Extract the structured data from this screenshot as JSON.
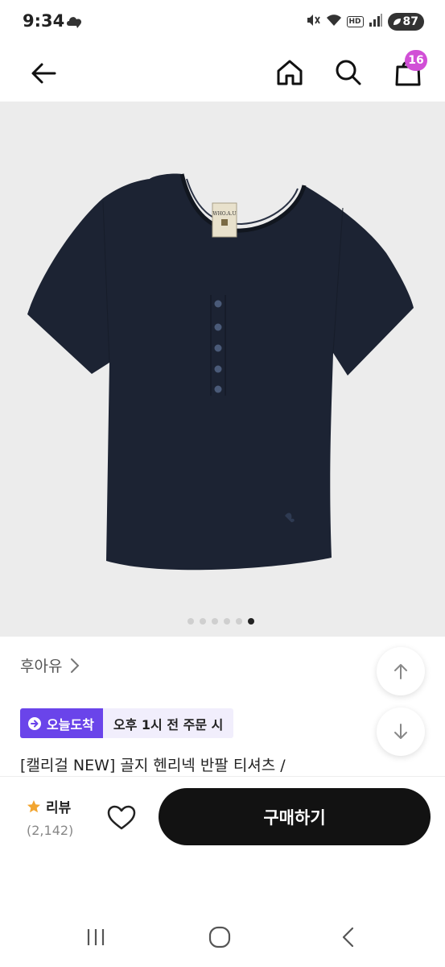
{
  "status_bar": {
    "time": "9:34",
    "network_badge": "HD",
    "battery": "87"
  },
  "app_bar": {
    "cart_count": "16",
    "icons": [
      "back-arrow-icon",
      "home-icon",
      "search-icon",
      "cart-icon"
    ]
  },
  "product": {
    "image": {
      "description_icon": "navy-henley-tshirt",
      "label_text": "WHO.A.U",
      "total_images": 6,
      "active_image_index": 5
    },
    "brand": "후아유",
    "delivery_badge": "오늘도착",
    "delivery_text": "오후 1시 전 주문 시",
    "title": "[캘리걸 NEW] 골지 헨리넥 반팔 티셔츠 /"
  },
  "action_bar": {
    "review_label": "리뷰",
    "review_count": "(2,142)",
    "buy_label": "구매하기"
  },
  "colors": {
    "delivery_badge_bg": "#6a44ea",
    "cart_badge_bg": "#d14fd6",
    "buy_button_bg": "#121212",
    "star": "#f2a530",
    "shirt": "#1c2333"
  }
}
